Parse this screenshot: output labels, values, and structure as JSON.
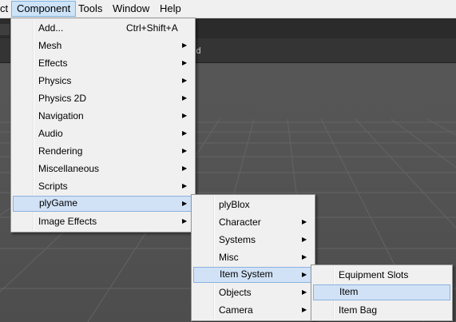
{
  "menubar": {
    "items": [
      {
        "label": "ct"
      },
      {
        "label": "Component"
      },
      {
        "label": "Tools"
      },
      {
        "label": "Window"
      },
      {
        "label": "Help"
      }
    ]
  },
  "editor": {
    "tab_fragment": "xEd"
  },
  "component_menu": {
    "items": [
      {
        "label": "Add...",
        "shortcut": "Ctrl+Shift+A"
      },
      {
        "label": "Mesh"
      },
      {
        "label": "Effects"
      },
      {
        "label": "Physics"
      },
      {
        "label": "Physics 2D"
      },
      {
        "label": "Navigation"
      },
      {
        "label": "Audio"
      },
      {
        "label": "Rendering"
      },
      {
        "label": "Miscellaneous"
      },
      {
        "label": "Scripts"
      },
      {
        "label": "plyGame"
      },
      {
        "label": "Image Effects"
      }
    ]
  },
  "plygame_menu": {
    "items": [
      {
        "label": "plyBlox"
      },
      {
        "label": "Character"
      },
      {
        "label": "Systems"
      },
      {
        "label": "Misc"
      },
      {
        "label": "Item System"
      },
      {
        "label": "Objects"
      },
      {
        "label": "Camera"
      }
    ]
  },
  "item_system_menu": {
    "items": [
      {
        "label": "Equipment Slots"
      },
      {
        "label": "Item"
      },
      {
        "label": "Item Bag"
      }
    ]
  },
  "icons": {
    "submenu_arrow": "▶"
  },
  "colors": {
    "highlight_bg": "#d1e2f6",
    "highlight_border": "#8bb1dd",
    "menu_bg": "#f0f0f0",
    "scene_bg": "#4d4d4d"
  }
}
